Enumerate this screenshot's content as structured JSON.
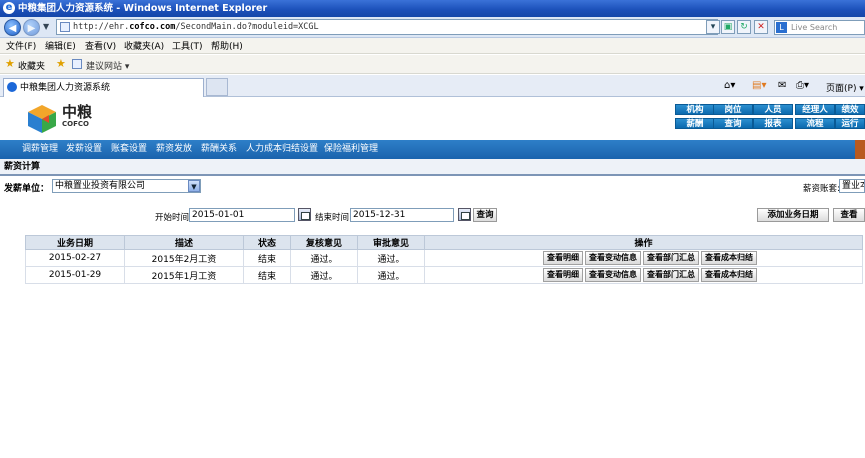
{
  "window": {
    "title": "中粮集团人力资源系统 - Windows Internet Explorer"
  },
  "address": {
    "url_prefix": "http://ehr.",
    "url_host": "cofco.com",
    "url_rest": "/SecondMain.do?moduleid=XCGL",
    "search_placeholder": "Live Search"
  },
  "menu": [
    "文件(F)",
    "编辑(E)",
    "查看(V)",
    "收藏夹(A)",
    "工具(T)",
    "帮助(H)"
  ],
  "favorites": {
    "label": "收藏夹",
    "suggested": "建议网站 ▾"
  },
  "tab": {
    "label": "中粮集团人力资源系统",
    "page_menu": "页面(P) ▾"
  },
  "logo": {
    "cn": "中粮",
    "en": "COFCO"
  },
  "header_nav": {
    "row1": [
      "机构",
      "岗位",
      "人员",
      "经理人",
      "绩效"
    ],
    "row2": [
      "薪酬",
      "查询",
      "报表",
      "流程",
      "运行"
    ]
  },
  "navbar": [
    "调薪管理",
    "发薪设置",
    "账套设置",
    "薪资发放",
    "薪酬关系",
    "人力成本归结设置",
    "保险福利管理"
  ],
  "page_title": "薪资计算",
  "filters": {
    "unit_label": "发薪单位：",
    "unit_value": "中粮置业投资有限公司",
    "account_label": "薪资账套:",
    "account_value": "置业本",
    "start_label": "开始时间",
    "start_value": "2015-01-01",
    "end_label": "结束时间",
    "end_value": "2015-12-31",
    "query_label": "查询",
    "add_date_label": "添加业务日期",
    "view_label": "查看"
  },
  "table": {
    "headers": [
      "业务日期",
      "描述",
      "状态",
      "复核意见",
      "审批意见",
      "操作"
    ],
    "rows": [
      {
        "date": "2015-02-27",
        "desc": "2015年2月工资",
        "status": "结束",
        "review": "通过。",
        "approve": "通过。"
      },
      {
        "date": "2015-01-29",
        "desc": "2015年1月工资",
        "status": "结束",
        "review": "通过。",
        "approve": "通过。"
      }
    ],
    "actions": [
      "查看明细",
      "查看变动信息",
      "查看部门汇总",
      "查看成本归结"
    ]
  }
}
